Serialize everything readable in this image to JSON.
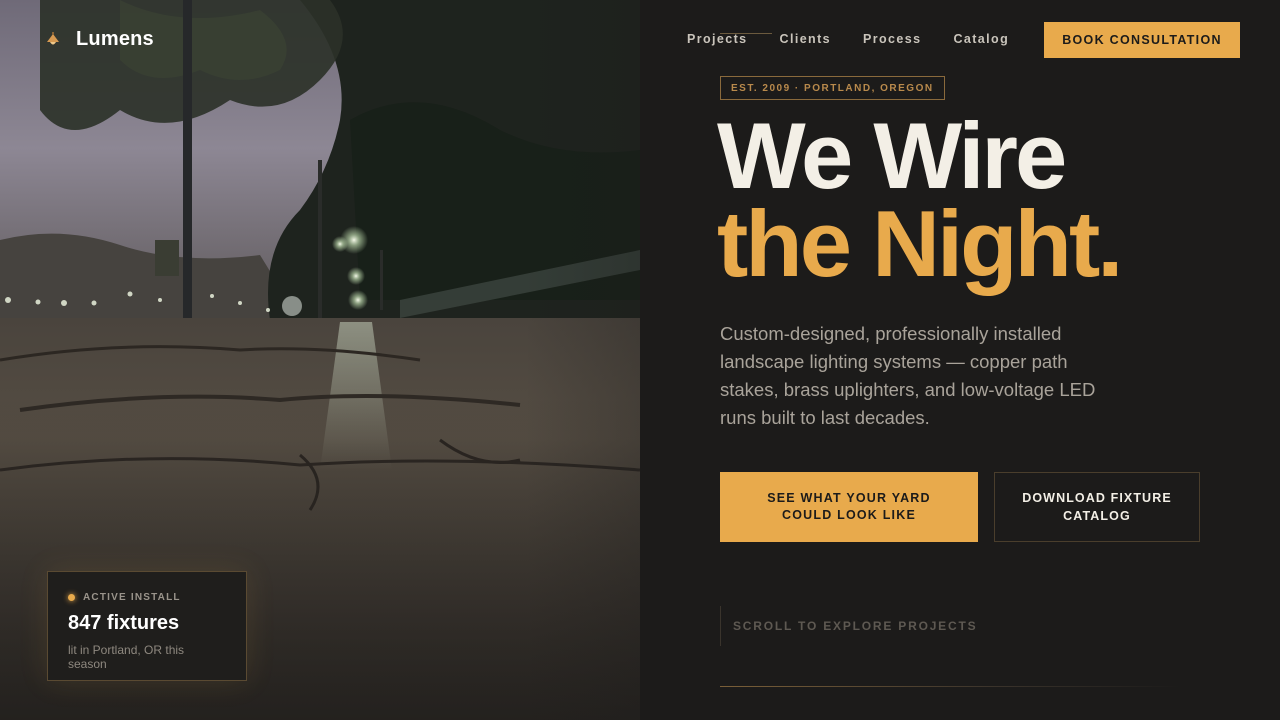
{
  "brand": {
    "name": "Lumens",
    "icon": "lamp-icon"
  },
  "nav": {
    "items": [
      {
        "label": "Projects"
      },
      {
        "label": "Clients"
      },
      {
        "label": "Process"
      },
      {
        "label": "Catalog"
      }
    ],
    "cta_label": "BOOK CONSULTATION"
  },
  "hero": {
    "eyebrow": "EST. 2009 · PORTLAND, OREGON",
    "headline_line1": "We Wire",
    "headline_line2": "the Night.",
    "lede": "Custom-designed, professionally installed landscape lighting systems — copper path stakes, brass uplighters, and low-voltage LED runs built to last decades.",
    "primary_cta": "SEE WHAT YOUR YARD COULD LOOK LIKE",
    "secondary_cta": "DOWNLOAD FIXTURE CATALOG",
    "scroll_hint": "SCROLL TO EXPLORE PROJECTS"
  },
  "stat_card": {
    "kicker": "ACTIVE INSTALL",
    "value": "847 fixtures",
    "note": "lit in Portland, OR this season"
  },
  "colors": {
    "accent": "#e8aa4c",
    "background": "#1c1b1a",
    "text": "#f3efe6",
    "muted": "#a9a39a"
  }
}
